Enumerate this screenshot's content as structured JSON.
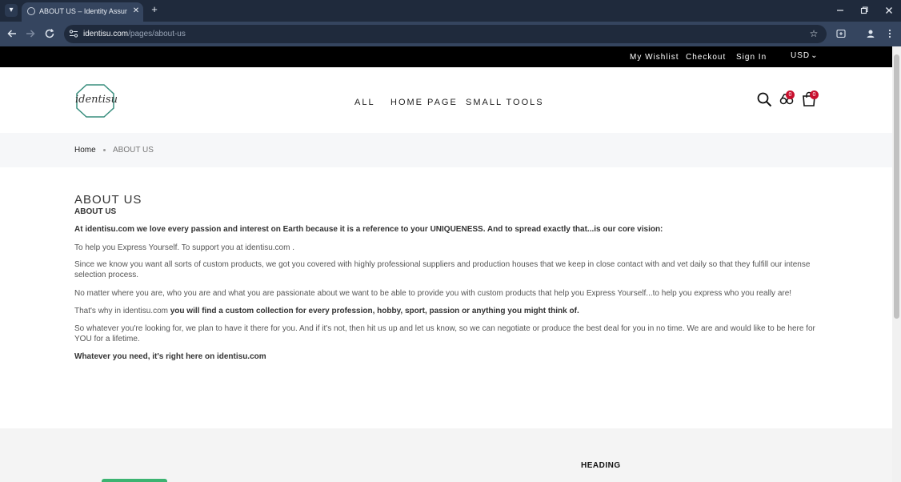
{
  "browser": {
    "tab_title": "ABOUT US – Identity Assurance",
    "tab_close": "✕",
    "new_tab": "+",
    "url_host": "identisu.com",
    "url_path": "/pages/about-us"
  },
  "topbar": {
    "wishlist": "My Wishlist",
    "checkout": "Checkout",
    "signin": "Sign In",
    "currency": "USD"
  },
  "header": {
    "logo_text": "identisu",
    "nav": [
      "ALL",
      "HOME PAGE",
      "SMALL TOOLS"
    ],
    "compare_count": "0",
    "cart_count": "0"
  },
  "breadcrumb": {
    "home": "Home",
    "current": "ABOUT US"
  },
  "content": {
    "title": "ABOUT US",
    "subtitle": "ABOUT US",
    "p1": "At identisu.com  we love every passion and interest on Earth because it is a reference to your UNIQUENESS. And to spread exactly that...is our core vision:",
    "p2": "To help you Express Yourself. To support you at identisu.com .",
    "p3": "Since we know you want all sorts of custom products, we got you covered with highly professional suppliers and production houses that we keep in close contact with and vet daily so that they fulfill our intense selection process.",
    "p4": "No matter where you are, who you are and what you are passionate about we want to be able to provide you with custom products that help you Express Yourself...to help you express who you really are!",
    "p5_prefix": "That's why in identisu.com ",
    "p5_bold": " you will find a custom collection for every profession, hobby, sport, passion or anything you might think of.",
    "p6": "So whatever you're looking for, we plan to have it there for you. And if it's not, then hit us up and let us know, so we can negotiate or produce the best deal for you in no time. We are and would like to be here for YOU for a lifetime.",
    "p7": "Whatever you need, it's right here on identisu.com"
  },
  "footer": {
    "heading": "HEADING"
  }
}
